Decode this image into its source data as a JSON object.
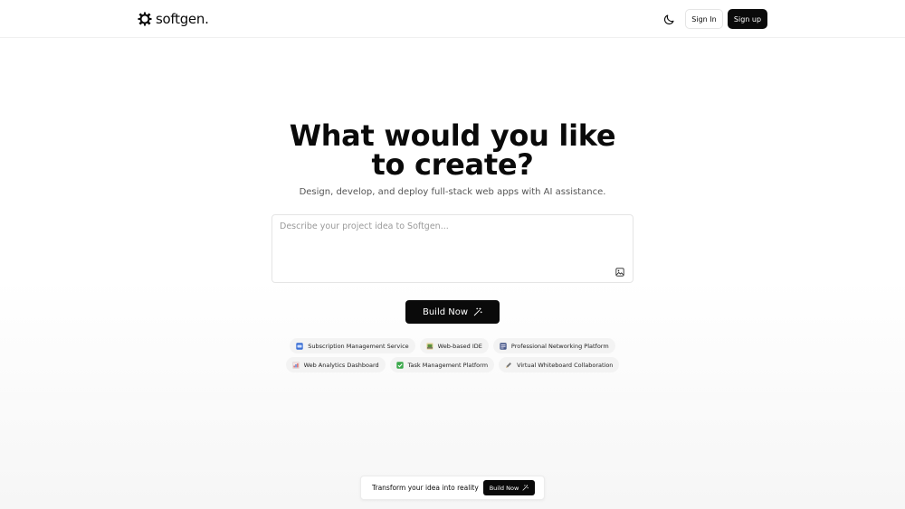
{
  "header": {
    "logo_text": "softgen",
    "logo_dot": ".",
    "signin_label": "Sign In",
    "signup_label": "Sign up"
  },
  "hero": {
    "title_line1": "What would you like",
    "title_line2": "to create?",
    "subtitle": "Design, develop, and deploy full-stack web apps with AI assistance."
  },
  "prompt": {
    "placeholder": "Describe your project idea to Softgen...",
    "value": ""
  },
  "build_label": "Build Now",
  "suggestions": [
    {
      "label": "Subscription Management Service",
      "icon": "credit-card-icon",
      "color": "#3b6fd4"
    },
    {
      "label": "Web-based IDE",
      "icon": "laptop-icon",
      "color": "#5a8f3a"
    },
    {
      "label": "Professional Networking Platform",
      "icon": "briefcase-icon",
      "color": "#4a5a8a"
    },
    {
      "label": "Web Analytics Dashboard",
      "icon": "chart-icon",
      "color": "#d05050"
    },
    {
      "label": "Task Management Platform",
      "icon": "checkbox-icon",
      "color": "#3aa84a"
    },
    {
      "label": "Virtual Whiteboard Collaboration",
      "icon": "pencil-icon",
      "color": "#555555"
    }
  ],
  "cta": {
    "text": "Transform your idea into reality",
    "button_label": "Build Now"
  },
  "colors": {
    "primary": "#0a0a0a",
    "chip_bg": "#f3f3f3"
  }
}
